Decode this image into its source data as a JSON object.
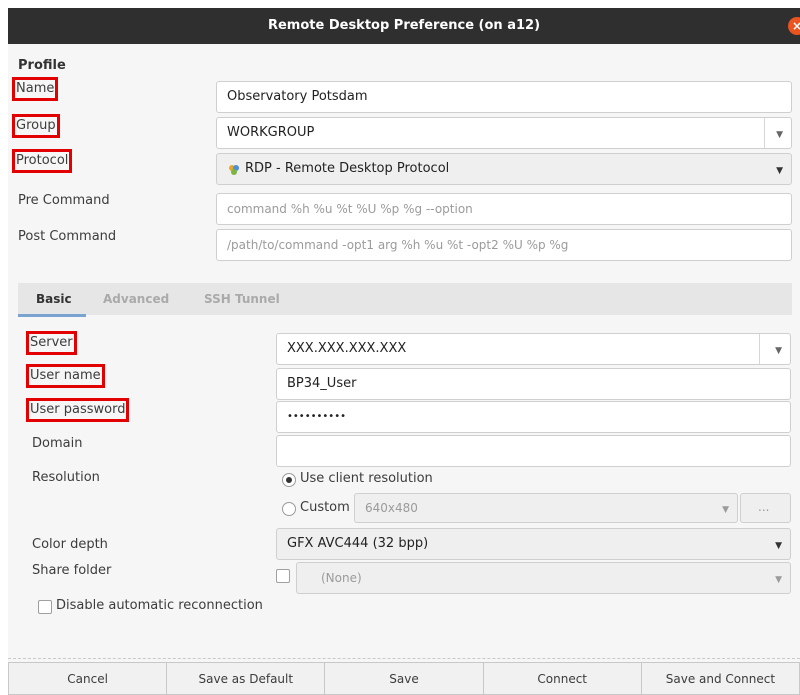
{
  "window": {
    "title": "Remote Desktop Preference (on a12)"
  },
  "profile": {
    "section_title": "Profile",
    "name_label": "Name",
    "name_value": "Observatory Potsdam",
    "group_label": "Group",
    "group_value": "WORKGROUP",
    "protocol_label": "Protocol",
    "protocol_value": "RDP - Remote Desktop Protocol",
    "pre_command_label": "Pre Command",
    "pre_command_placeholder": "command %h %u %t %U %p %g --option",
    "post_command_label": "Post Command",
    "post_command_placeholder": "/path/to/command -opt1 arg %h %u %t -opt2 %U %p %g"
  },
  "tabs": [
    "Basic",
    "Advanced",
    "SSH Tunnel"
  ],
  "basic": {
    "server_label": "Server",
    "server_value": "XXX.XXX.XXX.XXX",
    "username_label": "User name",
    "username_value": "BP34_User",
    "password_label": "User password",
    "password_value": "••••••••••",
    "domain_label": "Domain",
    "domain_value": "",
    "resolution_label": "Resolution",
    "use_client_resolution": "Use client resolution",
    "custom_label": "Custom",
    "custom_value": "640x480",
    "more_button": "...",
    "color_depth_label": "Color depth",
    "color_depth_value": "GFX AVC444 (32 bpp)",
    "share_folder_label": "Share folder",
    "share_folder_value": "(None)",
    "disable_reconnect_label": "Disable automatic reconnection"
  },
  "buttons": {
    "cancel": "Cancel",
    "save_default": "Save as Default",
    "save": "Save",
    "connect": "Connect",
    "save_connect": "Save and Connect"
  },
  "colors": {
    "titlebar": "#2f2f2f",
    "close": "#e95420",
    "highlight": "#e30000",
    "tab_accent": "#7aa3cf"
  }
}
